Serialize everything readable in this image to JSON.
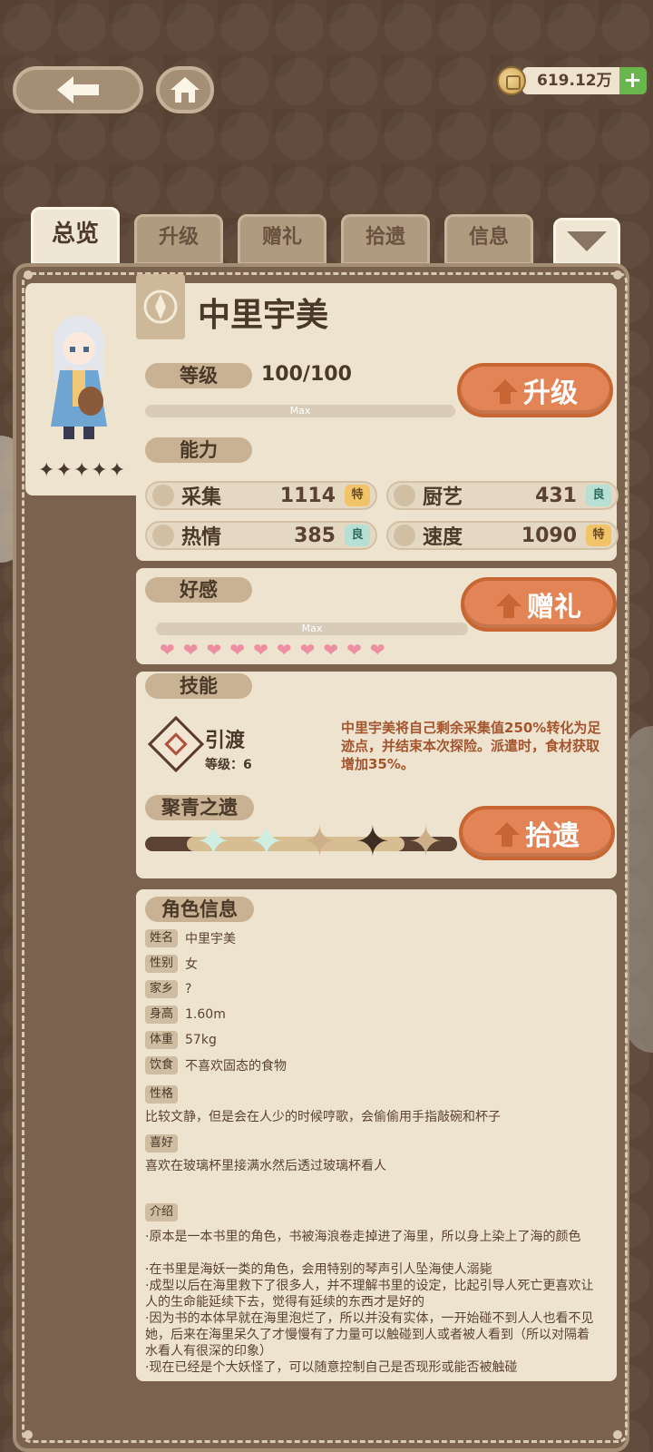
{
  "currency": {
    "amount": "619.12万",
    "plus": "+"
  },
  "tabs": [
    "总览",
    "升级",
    "赠礼",
    "拾遗",
    "信息"
  ],
  "character": {
    "name": "中里宇美",
    "stars": "✦✦✦✦✦",
    "level_label": "等级",
    "level_value": "100/100",
    "level_bar_text": "Max",
    "upgrade_button": "升级"
  },
  "ability": {
    "title": "能力",
    "stats": [
      {
        "name": "采集",
        "value": "1114",
        "grade": "特"
      },
      {
        "name": "厨艺",
        "value": "431",
        "grade": "良"
      },
      {
        "name": "热情",
        "value": "385",
        "grade": "良"
      },
      {
        "name": "速度",
        "value": "1090",
        "grade": "特"
      }
    ]
  },
  "affection": {
    "title": "好感",
    "bar_text": "Max",
    "hearts": 10,
    "gift_button": "赠礼"
  },
  "skill": {
    "title": "技能",
    "name": "引渡",
    "level": "等级：6",
    "description": "中里宇美将自己剩余采集值250%转化为足迹点，并结束本次探险。派遣时，食材获取增加35%。"
  },
  "relic": {
    "title": "聚青之遗",
    "button": "拾遗",
    "stars_lit": 2,
    "stars_total": 5
  },
  "profile": {
    "title": "角色信息",
    "rows": [
      {
        "label": "姓名",
        "value": "中里宇美"
      },
      {
        "label": "性别",
        "value": "女"
      },
      {
        "label": "家乡",
        "value": "?"
      },
      {
        "label": "身高",
        "value": "1.60m"
      },
      {
        "label": "体重",
        "value": "57kg"
      },
      {
        "label": "饮食",
        "value": "不喜欢固态的食物"
      }
    ],
    "personality_label": "性格",
    "personality": "比较文静，但是会在人少的时候哼歌，会偷偷用手指敲碗和杯子",
    "hobby_label": "喜好",
    "hobby": "喜欢在玻璃杯里接满水然后透过玻璃杯看人",
    "intro_label": "介绍",
    "intro": [
      "·原本是一本书里的角色，书被海浪卷走掉进了海里，所以身上染上了海的颜色",
      "·在书里是海妖一类的角色，会用特别的琴声引人坠海使人溺毙",
      "·成型以后在海里救下了很多人，并不理解书里的设定，比起引导人死亡更喜欢让人的生命能延续下去，觉得有延续的东西才是好的",
      "·因为书的本体早就在海里泡烂了，所以并没有实体，一开始碰不到人人也看不见她，后来在海里呆久了才慢慢有了力量可以触碰到人或者被人看到（所以对隔着水看人有很深的印象）",
      "·现在已经是个大妖怪了，可以随意控制自己是否现形或能否被触碰"
    ]
  }
}
